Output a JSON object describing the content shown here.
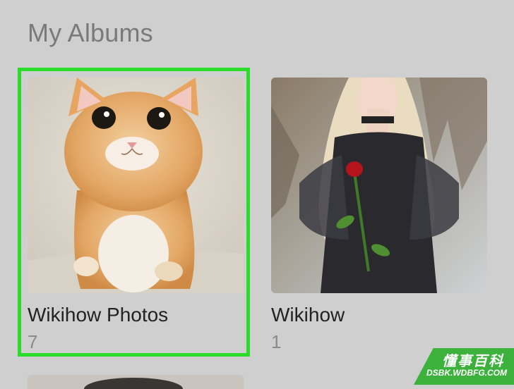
{
  "section": {
    "title": "My Albums"
  },
  "albums": [
    {
      "name": "Wikihow Photos",
      "count": "7",
      "selected": true,
      "thumbnail": "orange kitten photo"
    },
    {
      "name": "Wikihow",
      "count": "1",
      "selected": false,
      "thumbnail": "woman in black dress holding a rose"
    }
  ],
  "watermark": {
    "cn": "懂事百科",
    "url": "DSBK.WDBFG.COM"
  },
  "colors": {
    "highlight": "#2bdc2b",
    "background": "#cfcfcf",
    "watermark": "#3cb13c"
  }
}
